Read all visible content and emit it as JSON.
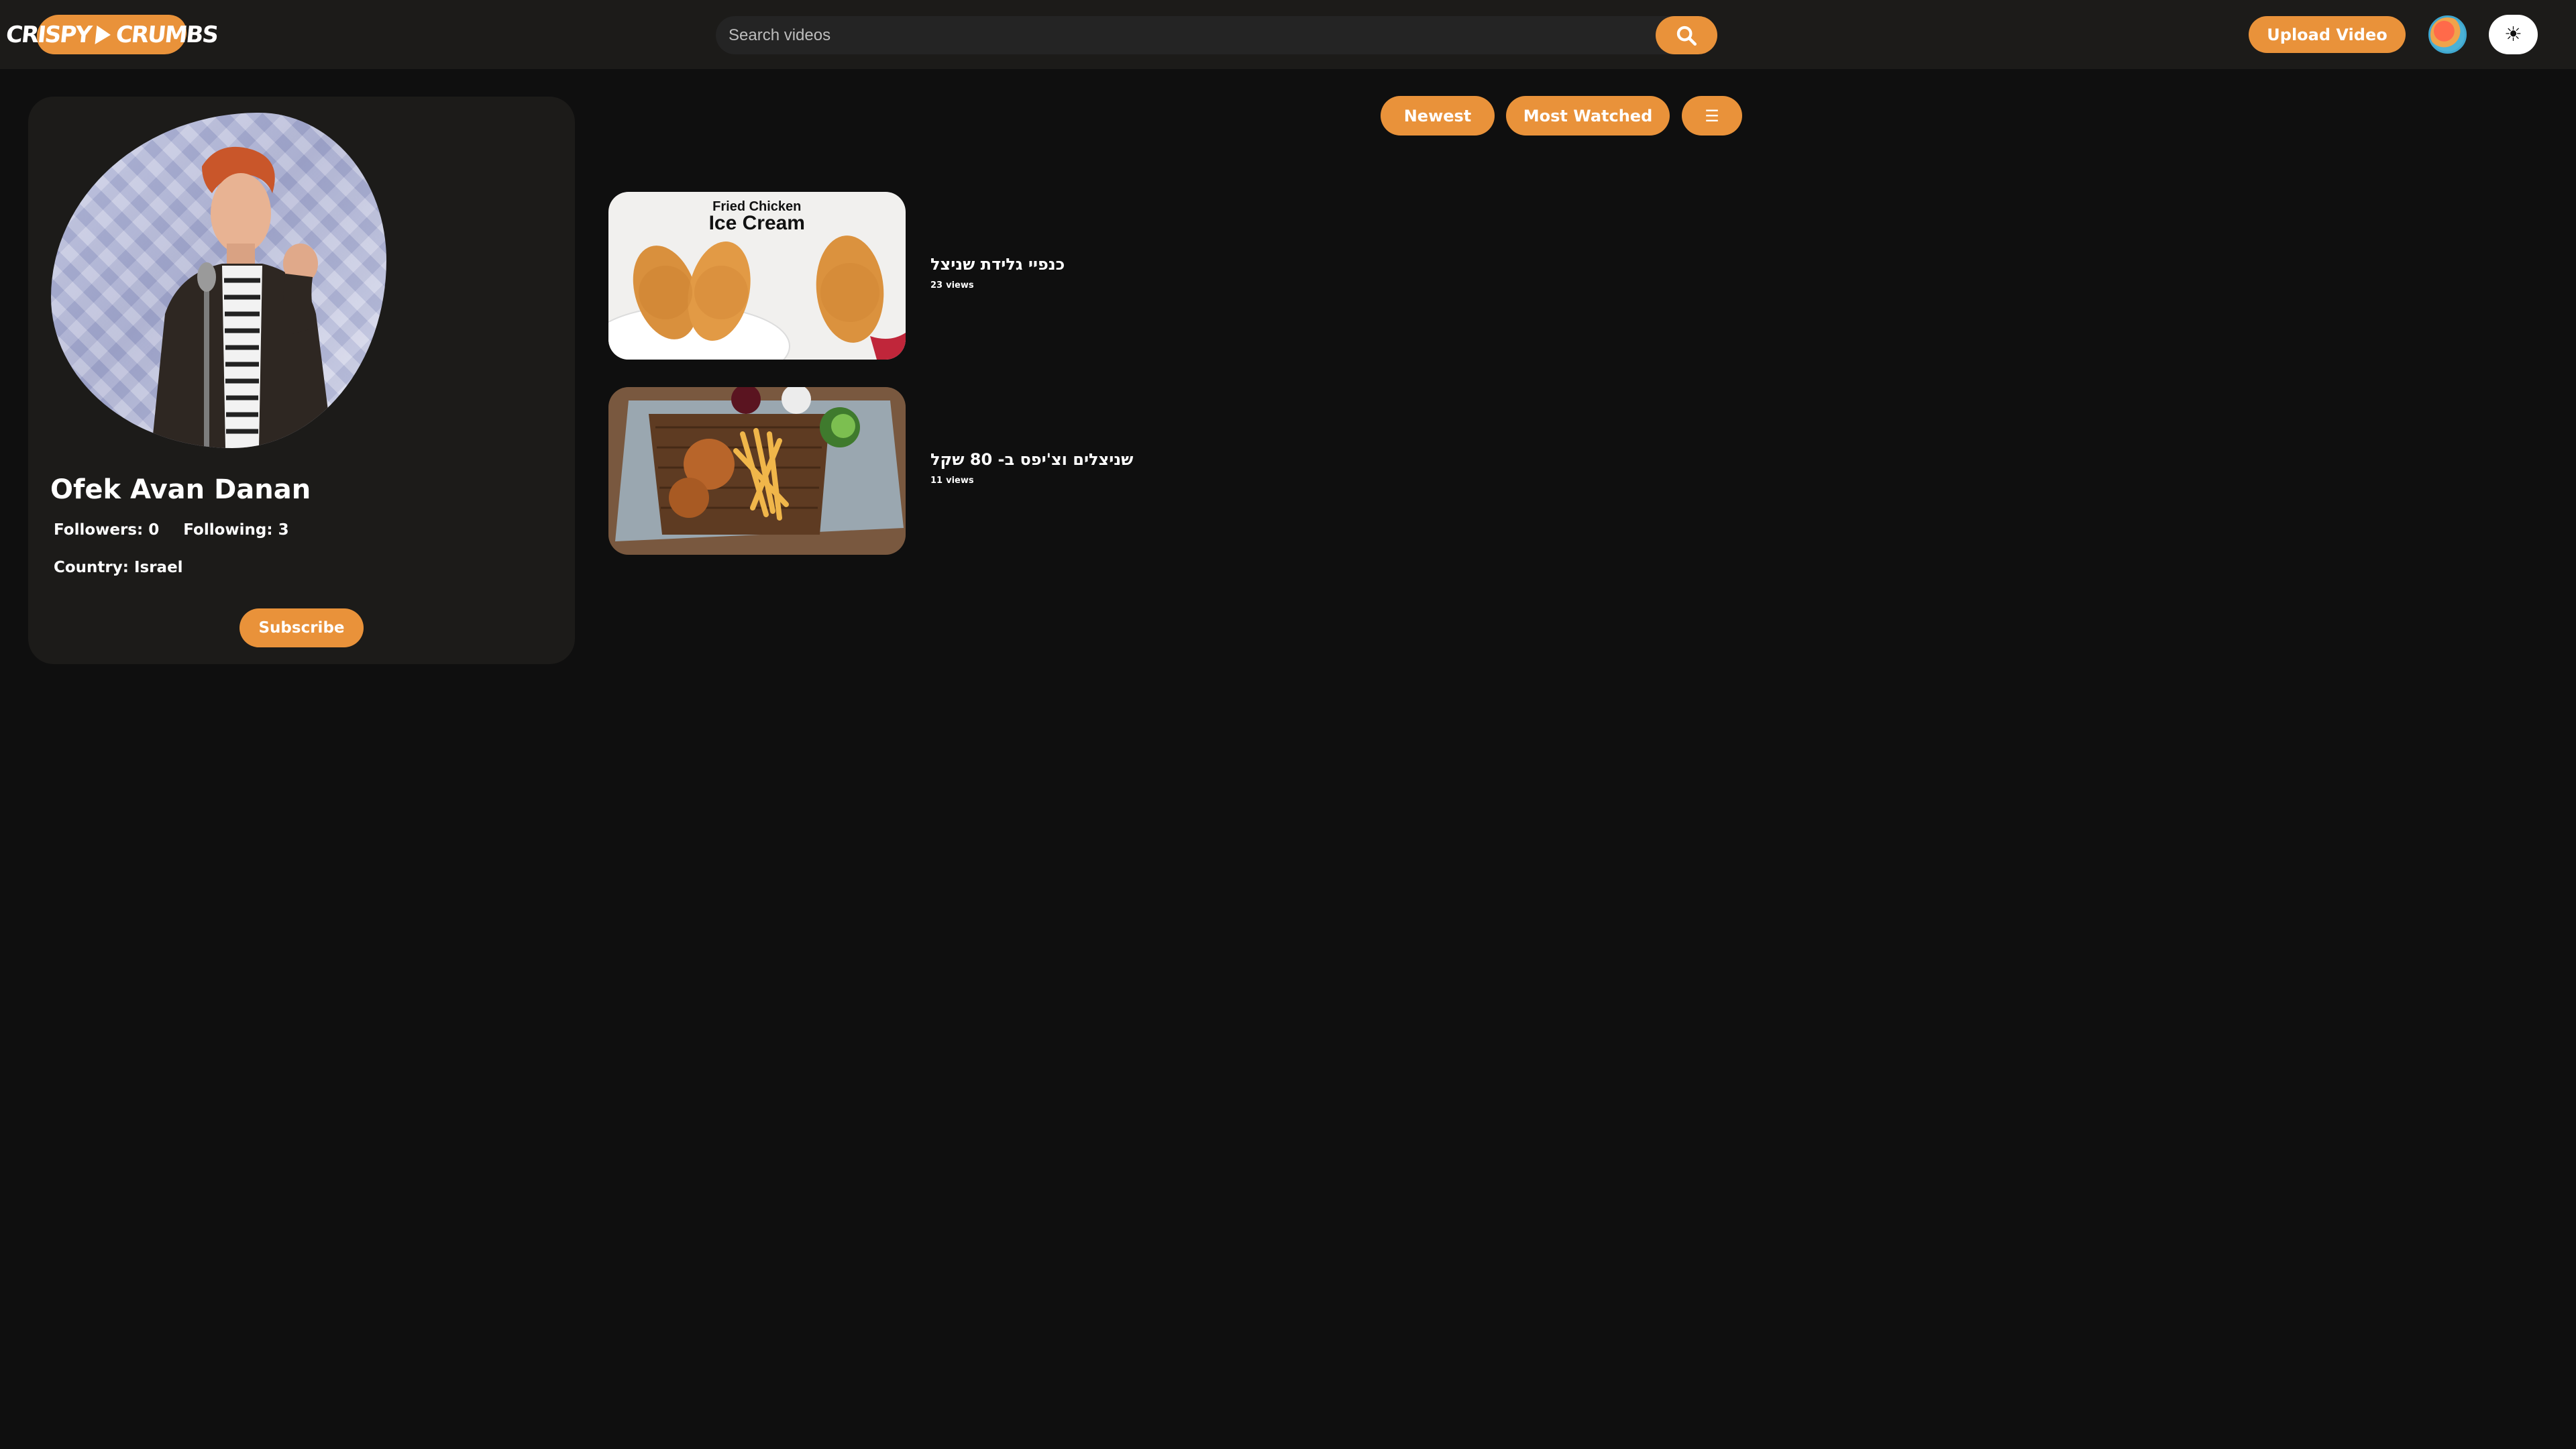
{
  "header": {
    "logo_left": "CRISPY",
    "logo_right": "CRUMBS",
    "search_placeholder": "Search videos",
    "upload_label": "Upload Video",
    "theme_icon": "☀"
  },
  "colors": {
    "accent": "#e9923a",
    "background": "#0f0f0f",
    "card": "#1c1b19"
  },
  "profile": {
    "name": "Ofek Avan Danan",
    "followers_label": "Followers:",
    "followers": "0",
    "following_label": "Following:",
    "following": "3",
    "country_label": "Country:",
    "country": "Israel",
    "subscribe_label": "Subscribe"
  },
  "sort": {
    "newest_label": "Newest",
    "most_watched_label": "Most Watched",
    "menu_icon": "☰"
  },
  "videos": [
    {
      "title": "כנפיי גלידת שניצל",
      "views": "23",
      "views_label": "views",
      "thumb_line1": "Fried Chicken",
      "thumb_line2": "Ice Cream"
    },
    {
      "title": "שניצלים וצ'יפס ב- 80 שקל",
      "views": "11",
      "views_label": "views"
    }
  ]
}
